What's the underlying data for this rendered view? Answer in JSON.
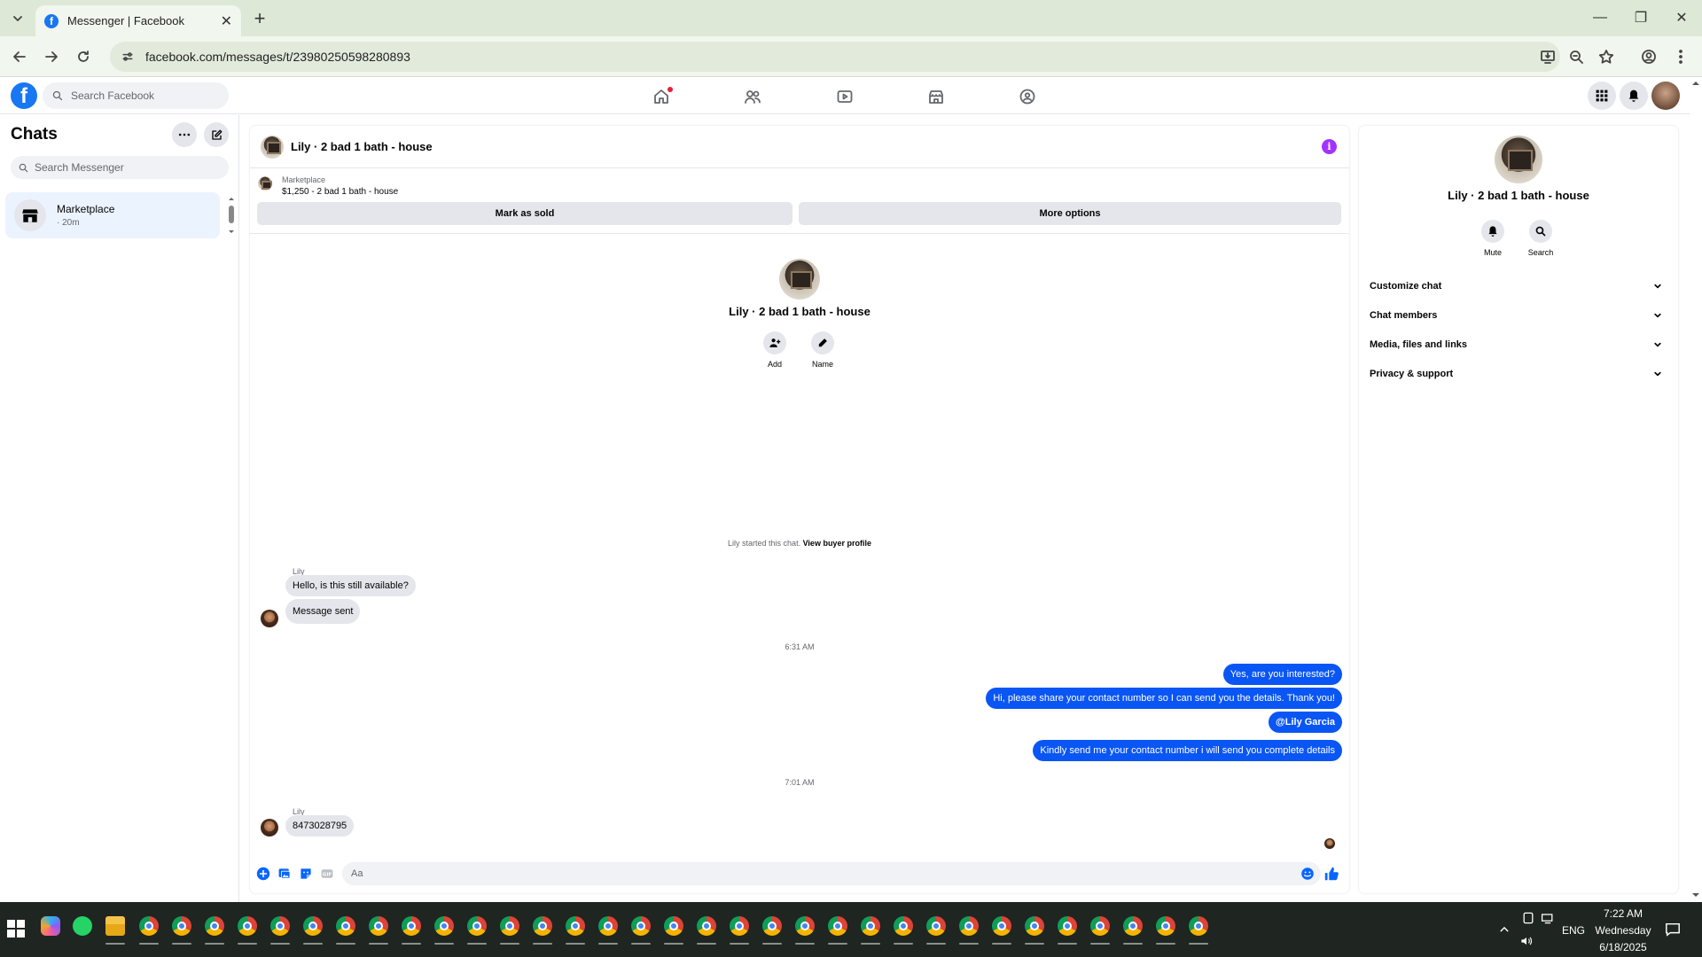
{
  "browser": {
    "tab_title": "Messenger | Facebook",
    "url": "facebook.com/messages/t/23980250598280893"
  },
  "facebook": {
    "search_placeholder": "Search Facebook"
  },
  "chats": {
    "title": "Chats",
    "search_placeholder": "Search Messenger",
    "items": [
      {
        "name": "Marketplace",
        "time": "· 20m"
      }
    ]
  },
  "conversation": {
    "title": "Lily · 2 bad 1 bath - house",
    "marketplace_label": "Marketplace",
    "listing": "$1,250 - 2 bad 1 bath - house",
    "mark_sold": "Mark as sold",
    "more_options": "More options",
    "hero_actions": {
      "add": "Add",
      "name": "Name"
    },
    "started_text": "Lily started this chat.",
    "view_buyer_profile": "View buyer profile",
    "sender": "Lily",
    "incoming_1": "Hello, is this still available?",
    "incoming_2": "Message sent",
    "time_1": "6:31 AM",
    "outgoing": [
      "Yes, are you interested?",
      "Hi, please share your contact number so I can send you the details. Thank you!",
      "@Lily Garcia",
      "Kindly send me your contact number i will send you complete details"
    ],
    "time_2": "7:01 AM",
    "incoming_3": "8473028795",
    "composer_placeholder": "Aa"
  },
  "info_panel": {
    "name": "Lily · 2 bad 1 bath - house",
    "actions": {
      "mute": "Mute",
      "search": "Search"
    },
    "sections": [
      "Customize chat",
      "Chat members",
      "Media, files and links",
      "Privacy & support"
    ]
  },
  "taskbar": {
    "time": "7:22 AM",
    "day": "Wednesday",
    "date": "6/18/2025",
    "lang": "ENG"
  },
  "colors": {
    "accent": "#1877f2",
    "outgoing_bubble": "#0a56f4",
    "info_icon": "#a033ff"
  }
}
